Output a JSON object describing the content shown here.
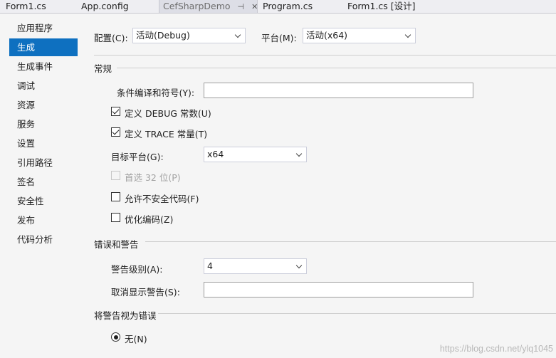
{
  "tabs": [
    {
      "label": "Form1.cs"
    },
    {
      "label": "App.config"
    },
    {
      "label": "CefSharpDemo",
      "active": true
    },
    {
      "label": "Program.cs"
    },
    {
      "label": "Form1.cs [设计]"
    }
  ],
  "tab_icons": {
    "pin": "⊣",
    "close": "✕"
  },
  "sidebar": {
    "items": [
      {
        "label": "应用程序"
      },
      {
        "label": "生成",
        "selected": true
      },
      {
        "label": "生成事件"
      },
      {
        "label": "调试"
      },
      {
        "label": "资源"
      },
      {
        "label": "服务"
      },
      {
        "label": "设置"
      },
      {
        "label": "引用路径"
      },
      {
        "label": "签名"
      },
      {
        "label": "安全性"
      },
      {
        "label": "发布"
      },
      {
        "label": "代码分析"
      }
    ]
  },
  "header": {
    "config_label": "配置(C):",
    "config_value": "活动(Debug)",
    "platform_label": "平台(M):",
    "platform_value": "活动(x64)"
  },
  "general": {
    "title": "常规",
    "conditional_symbols_label": "条件编译和符号(Y):",
    "conditional_symbols_value": "",
    "define_debug_label": "定义 DEBUG 常数(U)",
    "define_debug_checked": true,
    "define_trace_label": "定义 TRACE 常量(T)",
    "define_trace_checked": true,
    "target_platform_label": "目标平台(G):",
    "target_platform_value": "x64",
    "prefer32_label": "首选 32 位(P)",
    "prefer32_checked": false,
    "unsafe_label": "允许不安全代码(F)",
    "unsafe_checked": false,
    "optimize_label": "优化编码(Z)",
    "optimize_checked": false
  },
  "errors": {
    "title": "错误和警告",
    "warning_level_label": "警告级别(A):",
    "warning_level_value": "4",
    "suppress_label": "取消显示警告(S):",
    "suppress_value": ""
  },
  "treat_warnings": {
    "title": "将警告视为错误",
    "none_label": "无(N)",
    "none_selected": true
  },
  "watermark": "https://blog.csdn.net/ylq1045",
  "colors": {
    "accent": "#0e70c0",
    "background": "#f5f5f5"
  }
}
